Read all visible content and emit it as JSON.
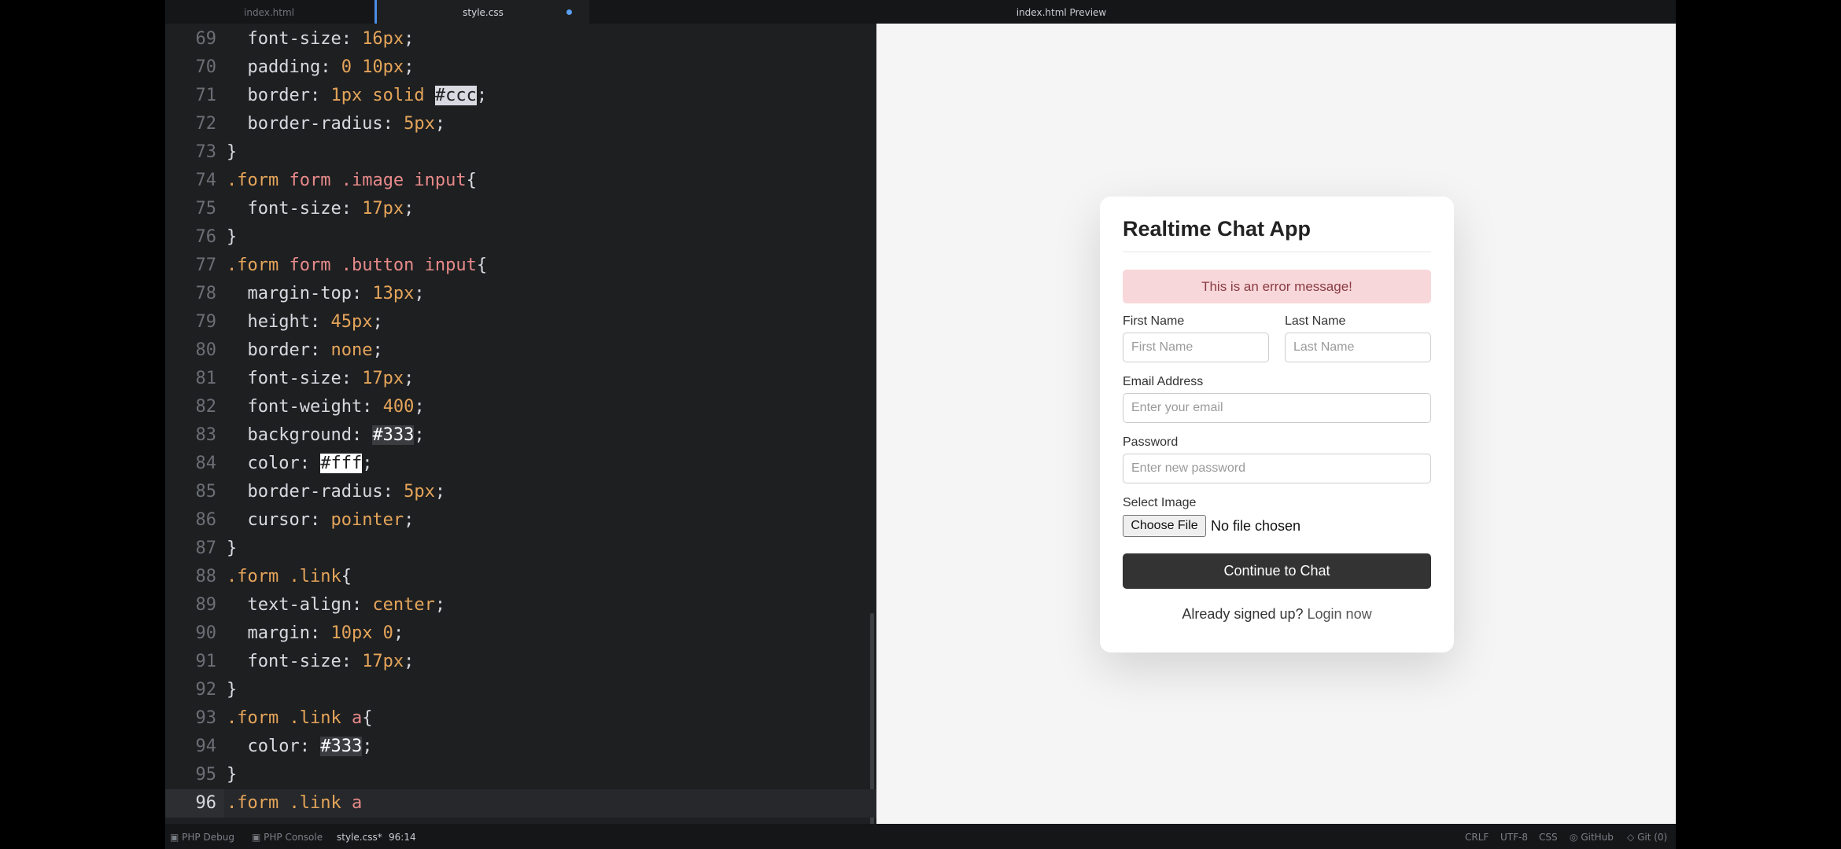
{
  "tabs": {
    "tab1": "index.html",
    "tab2": "style.css",
    "tab3": "index.html Preview"
  },
  "editor": {
    "lines": [
      {
        "num": "69",
        "tokens": [
          [
            "  font-size: ",
            "prop"
          ],
          [
            "16px",
            "num"
          ],
          [
            ";",
            "prop"
          ]
        ]
      },
      {
        "num": "70",
        "tokens": [
          [
            "  padding: ",
            "prop"
          ],
          [
            "0 10px",
            "num"
          ],
          [
            ";",
            "prop"
          ]
        ]
      },
      {
        "num": "71",
        "tokens": [
          [
            "  border: ",
            "prop"
          ],
          [
            "1px solid ",
            "num"
          ],
          [
            "#ccc",
            "hl"
          ],
          [
            ";",
            "prop"
          ]
        ]
      },
      {
        "num": "72",
        "tokens": [
          [
            "  border-radius: ",
            "prop"
          ],
          [
            "5px",
            "num"
          ],
          [
            ";",
            "prop"
          ]
        ]
      },
      {
        "num": "73",
        "tokens": [
          [
            "}",
            "prop"
          ]
        ]
      },
      {
        "num": "74",
        "tokens": [
          [
            ".form ",
            "dot"
          ],
          [
            "form .image input",
            "sel"
          ],
          [
            "{",
            "prop"
          ]
        ]
      },
      {
        "num": "75",
        "tokens": [
          [
            "  font-size: ",
            "prop"
          ],
          [
            "17px",
            "num"
          ],
          [
            ";",
            "prop"
          ]
        ]
      },
      {
        "num": "76",
        "tokens": [
          [
            "}",
            "prop"
          ]
        ]
      },
      {
        "num": "77",
        "tokens": [
          [
            ".form ",
            "dot"
          ],
          [
            "form .button input",
            "sel"
          ],
          [
            "{",
            "prop"
          ]
        ]
      },
      {
        "num": "78",
        "tokens": [
          [
            "  margin-top: ",
            "prop"
          ],
          [
            "13px",
            "num"
          ],
          [
            ";",
            "prop"
          ]
        ]
      },
      {
        "num": "79",
        "tokens": [
          [
            "  height: ",
            "prop"
          ],
          [
            "45px",
            "num"
          ],
          [
            ";",
            "prop"
          ]
        ]
      },
      {
        "num": "80",
        "tokens": [
          [
            "  border: ",
            "prop"
          ],
          [
            "none",
            "kw"
          ],
          [
            ";",
            "prop"
          ]
        ]
      },
      {
        "num": "81",
        "tokens": [
          [
            "  font-size: ",
            "prop"
          ],
          [
            "17px",
            "num"
          ],
          [
            ";",
            "prop"
          ]
        ]
      },
      {
        "num": "82",
        "tokens": [
          [
            "  font-weight: ",
            "prop"
          ],
          [
            "400",
            "num"
          ],
          [
            ";",
            "prop"
          ]
        ]
      },
      {
        "num": "83",
        "tokens": [
          [
            "  background: ",
            "prop"
          ],
          [
            "#333",
            "hl2"
          ],
          [
            ";",
            "prop"
          ]
        ]
      },
      {
        "num": "84",
        "tokens": [
          [
            "  color: ",
            "prop"
          ],
          [
            "#fff",
            "hlwhite"
          ],
          [
            ";",
            "prop"
          ]
        ]
      },
      {
        "num": "85",
        "tokens": [
          [
            "  border-radius: ",
            "prop"
          ],
          [
            "5px",
            "num"
          ],
          [
            ";",
            "prop"
          ]
        ]
      },
      {
        "num": "86",
        "tokens": [
          [
            "  cursor: ",
            "prop"
          ],
          [
            "pointer",
            "kw"
          ],
          [
            ";",
            "prop"
          ]
        ]
      },
      {
        "num": "87",
        "tokens": [
          [
            "}",
            "prop"
          ]
        ]
      },
      {
        "num": "88",
        "tokens": [
          [
            ".form ",
            "dot"
          ],
          [
            ".link",
            "dot"
          ],
          [
            "{",
            "prop"
          ]
        ]
      },
      {
        "num": "89",
        "tokens": [
          [
            "  text-align: ",
            "prop"
          ],
          [
            "center",
            "kw"
          ],
          [
            ";",
            "prop"
          ]
        ]
      },
      {
        "num": "90",
        "tokens": [
          [
            "  margin: ",
            "prop"
          ],
          [
            "10px 0",
            "num"
          ],
          [
            ";",
            "prop"
          ]
        ]
      },
      {
        "num": "91",
        "tokens": [
          [
            "  font-size: ",
            "prop"
          ],
          [
            "17px",
            "num"
          ],
          [
            ";",
            "prop"
          ]
        ]
      },
      {
        "num": "92",
        "tokens": [
          [
            "}",
            "prop"
          ]
        ]
      },
      {
        "num": "93",
        "tokens": [
          [
            ".form ",
            "dot"
          ],
          [
            ".link ",
            "dot"
          ],
          [
            "a",
            "sel"
          ],
          [
            "{",
            "prop"
          ]
        ]
      },
      {
        "num": "94",
        "tokens": [
          [
            "  color: ",
            "prop"
          ],
          [
            "#333",
            "hl2"
          ],
          [
            ";",
            "prop"
          ]
        ]
      },
      {
        "num": "95",
        "tokens": [
          [
            "}",
            "prop"
          ]
        ]
      },
      {
        "num": "96",
        "tokens": [
          [
            ".form ",
            "dot"
          ],
          [
            ".link ",
            "dot"
          ],
          [
            "a",
            "sel"
          ]
        ],
        "current": true
      }
    ]
  },
  "preview": {
    "title": "Realtime Chat App",
    "error_message": "This is an error message!",
    "first_name_label": "First Name",
    "first_name_placeholder": "First Name",
    "last_name_label": "Last Name",
    "last_name_placeholder": "Last Name",
    "email_label": "Email Address",
    "email_placeholder": "Enter your email",
    "password_label": "Password",
    "password_placeholder": "Enter new password",
    "image_label": "Select Image",
    "choose_file": "Choose File",
    "file_status": "No file chosen",
    "submit": "Continue to Chat",
    "signed_up_text": "Already signed up?",
    "login_link": "Login now"
  },
  "statusbar": {
    "php_debug": "PHP Debug",
    "php_console": "PHP Console",
    "file": "style.css*",
    "position": "96:14",
    "line_ending": "CRLF",
    "encoding": "UTF-8",
    "language": "CSS",
    "github": "GitHub",
    "git": "Git (0)"
  },
  "colors": {
    "accent": "#4a8ee6",
    "error_bg": "#f8d7da",
    "button_bg": "#333333"
  }
}
